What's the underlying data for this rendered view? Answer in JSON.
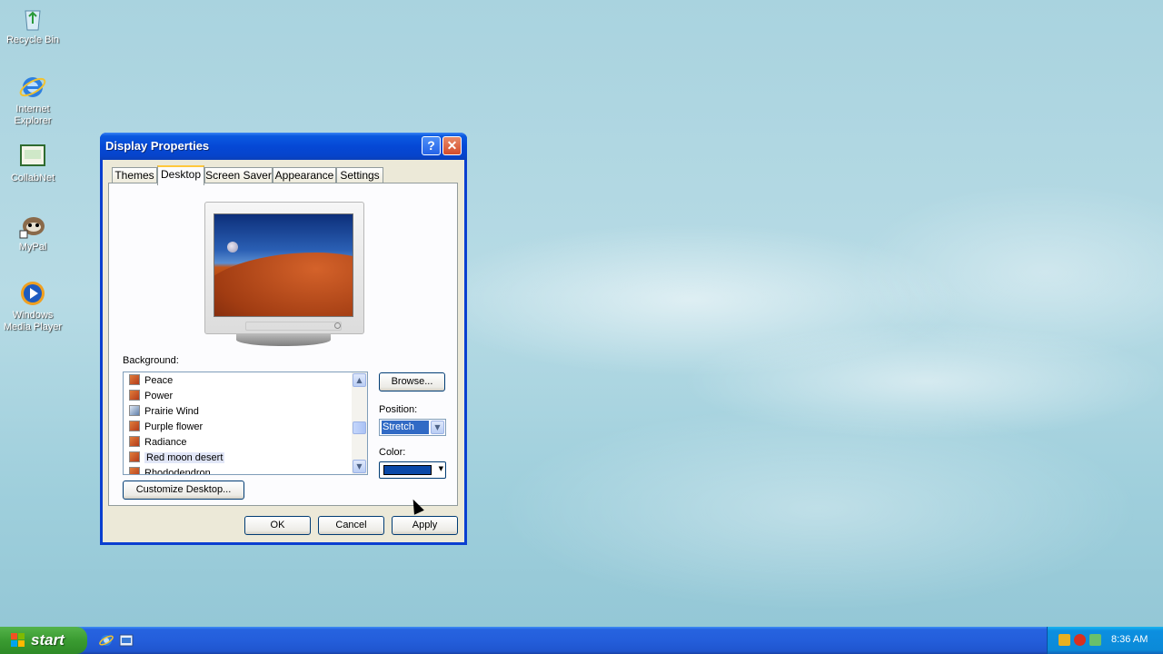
{
  "desktop": {
    "icons": [
      {
        "label": "Recycle Bin"
      },
      {
        "label": "Internet\nExplorer"
      },
      {
        "label": "CollabNet"
      },
      {
        "label": "MyPal"
      },
      {
        "label": "Windows\nMedia Player"
      }
    ]
  },
  "window": {
    "title": "Display Properties",
    "help_glyph": "?",
    "close_glyph": "✕",
    "tabs": [
      {
        "label": "Themes"
      },
      {
        "label": "Desktop"
      },
      {
        "label": "Screen Saver"
      },
      {
        "label": "Appearance"
      },
      {
        "label": "Settings"
      }
    ],
    "active_tab": "Desktop",
    "background_label": "Background:",
    "background_items": [
      {
        "label": "Peace"
      },
      {
        "label": "Power"
      },
      {
        "label": "Prairie Wind"
      },
      {
        "label": "Purple flower"
      },
      {
        "label": "Radiance"
      },
      {
        "label": "Red moon desert"
      },
      {
        "label": "Rhododendron"
      }
    ],
    "selected_background": "Red moon desert",
    "browse_label": "Browse...",
    "position_label": "Position:",
    "position_value": "Stretch",
    "color_label": "Color:",
    "color_value": "#0a49a8",
    "customize_label": "Customize Desktop...",
    "ok_label": "OK",
    "cancel_label": "Cancel",
    "apply_label": "Apply"
  },
  "taskbar": {
    "start_label": "start",
    "quick_launch": [
      "internet-explorer-icon",
      "show-desktop-icon"
    ],
    "tray_icons": [
      "security-shield-icon",
      "security-alert-icon",
      "network-icon"
    ],
    "clock": "8:36 AM"
  },
  "colors": {
    "titlebar": "#0548d6",
    "dialog_face": "#ece9d8",
    "selection": "#316ac5",
    "start_green": "#3a9b31",
    "taskbar_blue": "#245edb"
  }
}
